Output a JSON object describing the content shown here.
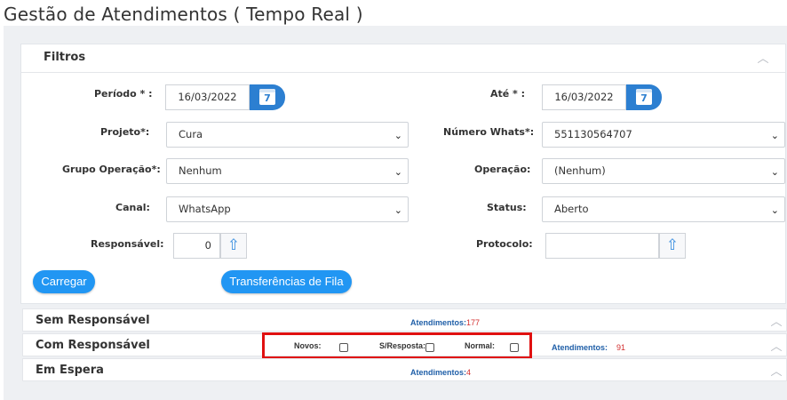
{
  "page": {
    "title": "Gestão de Atendimentos ( Tempo Real )"
  },
  "filters": {
    "title": "Filtros",
    "periodo": {
      "label": "Período * :",
      "value": "16/03/2022",
      "calendar_day": "7"
    },
    "ate": {
      "label": "Até * :",
      "value": "16/03/2022",
      "calendar_day": "7"
    },
    "projeto": {
      "label": "Projeto*:",
      "value": "Cura"
    },
    "numero_whats": {
      "label": "Número Whats*:",
      "value": "551130564707"
    },
    "grupo_operacao": {
      "label": "Grupo Operação*:",
      "value": "Nenhum"
    },
    "operacao": {
      "label": "Operação:",
      "value": "(Nenhum)"
    },
    "canal": {
      "label": "Canal:",
      "value": "WhatsApp"
    },
    "status": {
      "label": "Status:",
      "value": "Aberto"
    },
    "responsavel": {
      "label": "Responsável:",
      "value": "0"
    },
    "protocolo": {
      "label": "Protocolo:",
      "value": ""
    },
    "carregar_label": "Carregar",
    "transferencias_label": "Transferências de Fila"
  },
  "sections": {
    "sem_responsavel": {
      "title": "Sem Responsável",
      "atend_label": "Atendimentos:",
      "atend_count": "177"
    },
    "com_responsavel": {
      "title": "Com Responsável",
      "novos_label": "Novos:",
      "sresposta_label": "S/Resposta:",
      "normal_label": "Normal:",
      "atend_label": "Atendimentos:",
      "atend_count": "91"
    },
    "em_espera": {
      "title": "Em Espera",
      "atend_label": "Atendimentos:",
      "atend_count": "4"
    }
  },
  "colors": {
    "accent": "#2196f3",
    "calendar": "#2c7fd1",
    "highlight": "#e01010",
    "count": "#d32f2f",
    "link": "#1f5fa8"
  },
  "icons": {
    "calendar": "calendar-icon",
    "arrow_up": "arrow-up-icon",
    "chevron_up": "chevron-up-icon",
    "chevron_down": "chevron-down-icon"
  }
}
